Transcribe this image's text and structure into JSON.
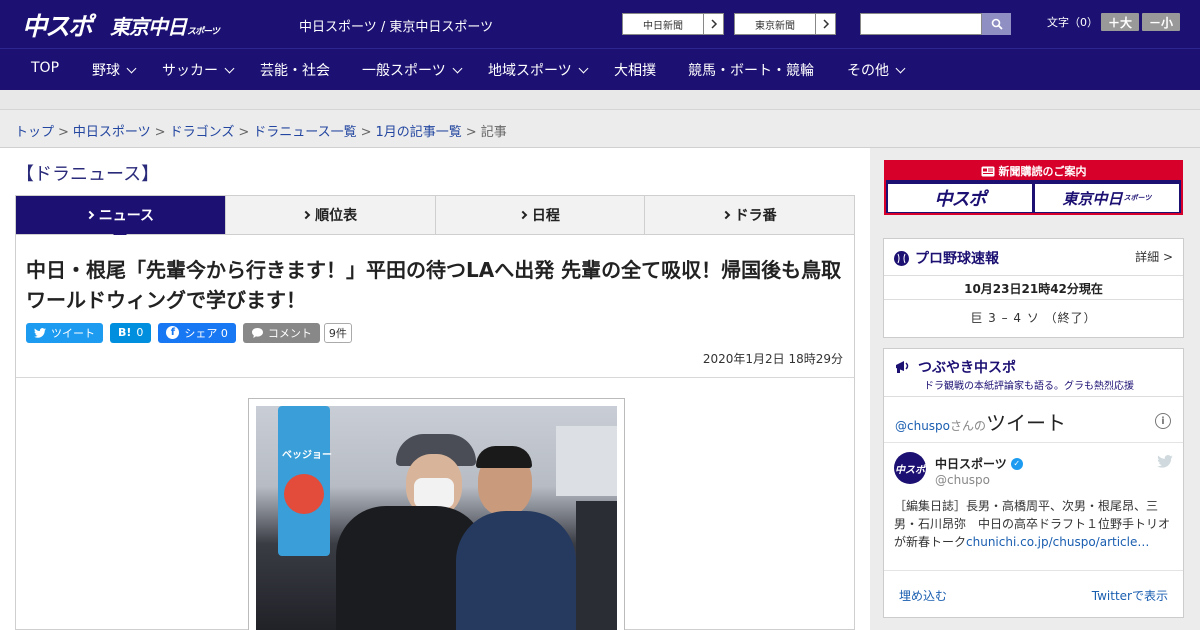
{
  "header": {
    "logo_chuspo": "中スポ",
    "logo_tokyo": "東京中日",
    "logo_tokyo_sub": "スポーツ",
    "site_names": "中日スポーツ / 東京中日スポーツ",
    "link_chunichi": "中日新聞",
    "link_tokyo": "東京新聞",
    "search_placeholder": "",
    "font_label": "文字（0）",
    "font_bigger": "＋大",
    "font_smaller": "－小"
  },
  "nav": {
    "items": [
      {
        "label": "TOP"
      },
      {
        "label": "野球"
      },
      {
        "label": "サッカー"
      },
      {
        "label": "芸能・社会"
      },
      {
        "label": "一般スポーツ"
      },
      {
        "label": "地域スポーツ"
      },
      {
        "label": "大相撲"
      },
      {
        "label": "競馬・ボート・競輪"
      },
      {
        "label": "その他"
      }
    ]
  },
  "breadcrumb": {
    "items": [
      "トップ",
      "中日スポーツ",
      "ドラゴンズ",
      "ドラニュース一覧",
      "1月の記事一覧"
    ],
    "current": "記事",
    "sep": ">"
  },
  "section": {
    "title": "【ドラニュース】"
  },
  "tabs": [
    {
      "label": "ニュース"
    },
    {
      "label": "順位表"
    },
    {
      "label": "日程"
    },
    {
      "label": "ドラ番"
    }
  ],
  "article": {
    "headline": "中日・根尾「先輩今から行きます！」平田の待つLAへ出発 先輩の全て吸収！帰国後も鳥取ワールドウィングで学びます！",
    "share": {
      "tweet": "ツイート",
      "hatena_icon": "B!",
      "hatena_count": "0",
      "facebook_icon": "f",
      "facebook_label": "シェア 0",
      "comment_label": "コメント",
      "comment_count": "9件"
    },
    "date": "2020年1月2日 18時29分",
    "photo_banner": "ベッジョー"
  },
  "sidebar": {
    "subscription": {
      "title": "新聞購読のご案内",
      "logo1": "中スポ",
      "logo2": "東京中日",
      "logo2_sub": "スポーツ"
    },
    "baseball": {
      "title": "プロ野球速報",
      "detail": "詳細 >",
      "time": "10月23日21時42分現在",
      "score": "巨 3 – 4 ソ （終了）"
    },
    "tweets": {
      "title": "つぶやき中スポ",
      "subtitle": "ドラ観戦の本紙評論家も語る。グラも熱烈応援",
      "handle": "@chuspo",
      "handle_suffix": "さんの",
      "handle_big": "ツイート",
      "avatar_text": "中スポ",
      "name": "中日スポーツ",
      "user": "@chuspo",
      "text": "［編集日誌］長男・高橋周平、次男・根尾昂、三男・石川昂弥　中日の高卒ドラフト１位野手トリオが新春トーク",
      "link": "chunichi.co.jp/chuspo/article…",
      "embed": "埋め込む",
      "view": "Twitterで表示"
    }
  }
}
